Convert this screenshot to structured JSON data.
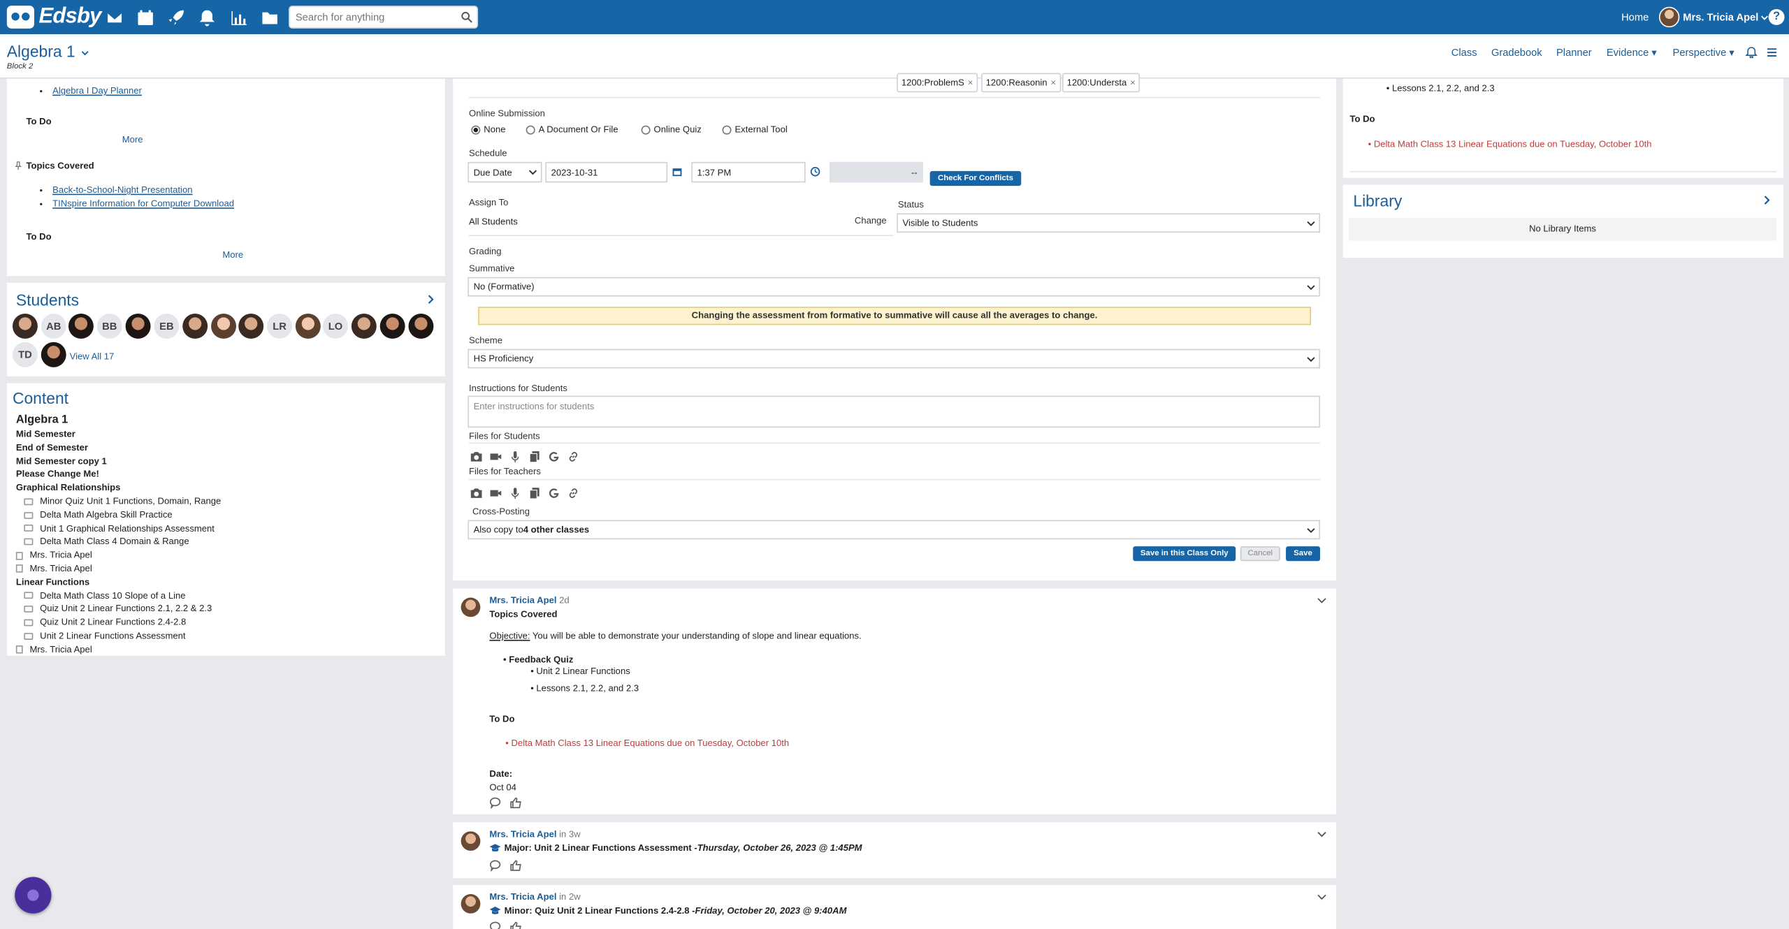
{
  "topbar": {
    "logo": "Edsby",
    "search_placeholder": "Search for anything",
    "home": "Home",
    "user": "Mrs. Tricia Apel",
    "help": "?"
  },
  "subheader": {
    "class_title": "Algebra 1",
    "block": "Block 2",
    "nav": [
      "Class",
      "Gradebook",
      "Planner",
      "Evidence",
      "Perspective"
    ]
  },
  "left_top": {
    "planner_link": "Algebra I Day Planner",
    "todo": "To Do",
    "more": "More",
    "topics_covered": "Topics Covered",
    "links": [
      "Back-to-School-Night Presentation",
      "TINspire Information for Computer Download"
    ],
    "todo2": "To Do",
    "more2": "More"
  },
  "students": {
    "title": "Students",
    "initials": [
      "AB",
      "BB",
      "EB",
      "LR",
      "LO",
      "TD"
    ],
    "view_all": "View All 17"
  },
  "content": {
    "title": "Content",
    "items": [
      {
        "text": "Algebra 1",
        "kind": "head"
      },
      {
        "text": "Mid Semester",
        "kind": "bold"
      },
      {
        "text": "End of Semester",
        "kind": "bold"
      },
      {
        "text": "Mid Semester copy 1",
        "kind": "bold"
      },
      {
        "text": "Please Change Me!",
        "kind": "bold"
      },
      {
        "text": "Graphical Relationships",
        "kind": "bold"
      },
      {
        "text": "Minor Quiz Unit 1 Functions, Domain, Range",
        "kind": "folder"
      },
      {
        "text": "Delta Math Algebra Skill Practice",
        "kind": "folder"
      },
      {
        "text": "Unit 1 Graphical Relationships Assessment",
        "kind": "folder"
      },
      {
        "text": "Delta Math Class 4 Domain & Range",
        "kind": "folder"
      },
      {
        "text": "Mrs. Tricia Apel",
        "kind": "doc"
      },
      {
        "text": "Mrs. Tricia Apel",
        "kind": "doc"
      },
      {
        "text": "Linear Functions",
        "kind": "bold"
      },
      {
        "text": "Delta Math Class 10 Slope of a Line",
        "kind": "folder"
      },
      {
        "text": "Quiz Unit 2 Linear Functions 2.1, 2.2 & 2.3",
        "kind": "folder"
      },
      {
        "text": "Quiz Unit 2 Linear Functions 2.4-2.8",
        "kind": "folder"
      },
      {
        "text": "Unit 2 Linear Functions Assessment",
        "kind": "folder"
      },
      {
        "text": "Mrs. Tricia Apel",
        "kind": "doc"
      }
    ]
  },
  "form": {
    "tags": [
      "1200:ProblemS",
      "1200:Reasonin",
      "1200:Understa"
    ],
    "online_submission": "Online Submission",
    "radios": [
      "None",
      "A Document Or File",
      "Online Quiz",
      "External Tool"
    ],
    "schedule": "Schedule",
    "due_select": "Due Date",
    "date": "2023-10-31",
    "time": "1:37 PM",
    "end": "--",
    "check_conflicts": "Check For Conflicts",
    "assign_to": "Assign To",
    "all_students": "All Students",
    "change": "Change",
    "status": "Status",
    "status_value": "Visible to Students",
    "grading": "Grading",
    "summative": "Summative",
    "summative_value": "No (Formative)",
    "warning": "Changing the assessment from formative to summative will cause all the averages to change.",
    "scheme": "Scheme",
    "scheme_value": "HS Proficiency",
    "instructions": "Instructions for Students",
    "instructions_placeholder": "Enter instructions for students",
    "files_students": "Files for Students",
    "files_teachers": "Files for Teachers",
    "cross_posting": "Cross-Posting",
    "cross_prefix": "Also copy to ",
    "cross_bold": "4 other classes",
    "save_class_only": "Save in this Class Only",
    "cancel": "Cancel",
    "save": "Save"
  },
  "posts": [
    {
      "author": "Mrs. Tricia Apel",
      "meta": "2d",
      "title": "Topics Covered",
      "objective_label": "Objective:",
      "objective_text": " You will be able to demonstrate your understanding of slope and linear equations.",
      "feedback_quiz": "Feedback Quiz",
      "sub": [
        "Unit 2 Linear Functions",
        "Lessons 2.1, 2.2, and 2.3"
      ],
      "todo": "To Do",
      "todo_item": "Delta Math Class 13 Linear Equations due on Tuesday, October 10th",
      "date_label": "Date:",
      "date_value": "Oct 04"
    },
    {
      "author": "Mrs. Tricia Apel",
      "meta": "in 3w",
      "title_prefix": "Major: Unit 2 Linear Functions Assessment - ",
      "title_date": "Thursday, October 26, 2023 @ 1:45PM"
    },
    {
      "author": "Mrs. Tricia Apel",
      "meta": "in 2w",
      "title_prefix": "Minor: Quiz Unit 2 Linear Functions 2.4-2.8  - ",
      "title_date": "Friday, October 20, 2023 @ 9:40AM"
    }
  ],
  "right": {
    "lesson_item": "Lessons 2.1, 2.2, and 2.3",
    "todo": "To Do",
    "todo_item": "Delta Math Class 13 Linear Equations due on Tuesday, October 10th",
    "library_title": "Library",
    "no_items": "No Library Items"
  }
}
